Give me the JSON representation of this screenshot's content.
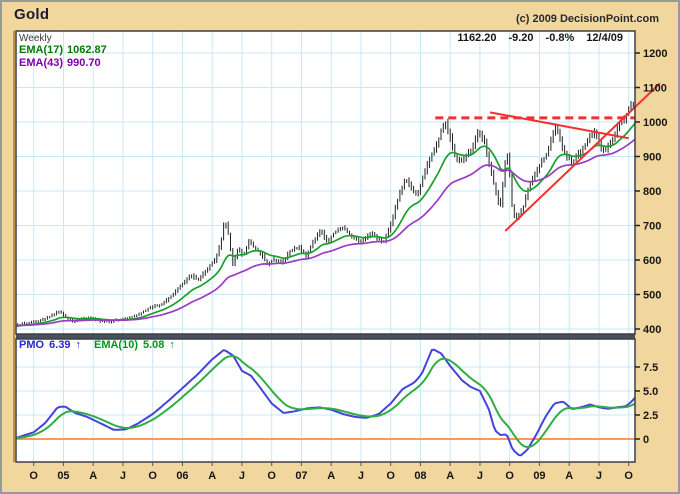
{
  "header": {
    "title": "Gold",
    "copyright": "(c) 2009 DecisionPoint.com"
  },
  "quote": {
    "last": "1162.20",
    "change": "-9.20",
    "percent": "-0.8%",
    "date": "12/4/09"
  },
  "legend": {
    "timeframe": "Weekly",
    "ema17_label": "EMA(17)",
    "ema17_value": "1062.87",
    "ema43_label": "EMA(43)",
    "ema43_value": "990.70"
  },
  "pmo_legend": {
    "pmo_label": "PMO",
    "pmo_value": "6.39",
    "pmo_arrow": "↑",
    "ema10_label": "EMA(10)",
    "ema10_value": "5.08",
    "ema10_arrow": "↑"
  },
  "colors": {
    "frame_background": "#f1d79e",
    "plot_background": "#ffffff",
    "grid": "#c9e8f8",
    "price_bars": "#222222",
    "ema17_line": "#1aa02c",
    "ema43_line": "#9a3dc4",
    "pmo_line": "#4444dd",
    "pmo_ema_line": "#2fae44",
    "zero_line": "#ff8844",
    "annotation_red": "#f23030",
    "divider": "#49505b",
    "axis_text": "#161616"
  },
  "chart_data": [
    {
      "type": "bar",
      "title": "Gold weekly price",
      "x_unit": "quarters since Oct 2004 (O 05 A J O ... O)",
      "x_tick_labels": [
        "O",
        "05",
        "A",
        "J",
        "O",
        "06",
        "A",
        "J",
        "O",
        "07",
        "A",
        "J",
        "O",
        "08",
        "A",
        "J",
        "O",
        "09",
        "A",
        "J",
        "O"
      ],
      "x_range": [
        -0.6,
        20.7
      ],
      "ylim": [
        385,
        1264
      ],
      "y_ticks": [
        1200,
        1100,
        1000,
        900,
        800,
        700,
        600,
        500,
        400
      ],
      "grid": true,
      "series": [
        {
          "name": "close",
          "type": "bars",
          "color": "#222222",
          "points": [
            [
              -0.6,
              410
            ],
            [
              -0.3,
              416
            ],
            [
              0,
              420
            ],
            [
              0.3,
              427
            ],
            [
              0.6,
              438
            ],
            [
              0.85,
              452
            ],
            [
              1.05,
              436
            ],
            [
              1.3,
              422
            ],
            [
              1.6,
              429
            ],
            [
              1.9,
              433
            ],
            [
              2.2,
              424
            ],
            [
              2.5,
              421
            ],
            [
              2.8,
              427
            ],
            [
              3.1,
              430
            ],
            [
              3.5,
              441
            ],
            [
              3.9,
              462
            ],
            [
              4.3,
              472
            ],
            [
              4.7,
              502
            ],
            [
              5,
              532
            ],
            [
              5.3,
              556
            ],
            [
              5.5,
              542
            ],
            [
              5.8,
              571
            ],
            [
              6.1,
              601
            ],
            [
              6.3,
              655
            ],
            [
              6.42,
              718
            ],
            [
              6.55,
              672
            ],
            [
              6.68,
              585
            ],
            [
              6.85,
              632
            ],
            [
              7.05,
              612
            ],
            [
              7.25,
              656
            ],
            [
              7.45,
              632
            ],
            [
              7.65,
              618
            ],
            [
              7.85,
              587
            ],
            [
              8.1,
              603
            ],
            [
              8.35,
              589
            ],
            [
              8.6,
              625
            ],
            [
              8.9,
              638
            ],
            [
              9.15,
              612
            ],
            [
              9.4,
              653
            ],
            [
              9.65,
              687
            ],
            [
              9.85,
              652
            ],
            [
              10.1,
              679
            ],
            [
              10.4,
              694
            ],
            [
              10.7,
              667
            ],
            [
              11,
              653
            ],
            [
              11.3,
              678
            ],
            [
              11.55,
              664
            ],
            [
              11.75,
              649
            ],
            [
              12,
              702
            ],
            [
              12.25,
              780
            ],
            [
              12.5,
              836
            ],
            [
              12.7,
              803
            ],
            [
              12.9,
              788
            ],
            [
              13.1,
              848
            ],
            [
              13.35,
              902
            ],
            [
              13.6,
              948
            ],
            [
              13.82,
              1006
            ],
            [
              14,
              955
            ],
            [
              14.2,
              886
            ],
            [
              14.45,
              892
            ],
            [
              14.7,
              918
            ],
            [
              14.95,
              978
            ],
            [
              15.15,
              942
            ],
            [
              15.35,
              862
            ],
            [
              15.55,
              792
            ],
            [
              15.68,
              748
            ],
            [
              15.85,
              882
            ],
            [
              15.95,
              908
            ],
            [
              16.1,
              732
            ],
            [
              16.25,
              722
            ],
            [
              16.45,
              752
            ],
            [
              16.65,
              818
            ],
            [
              16.85,
              848
            ],
            [
              17.05,
              882
            ],
            [
              17.25,
              908
            ],
            [
              17.45,
              968
            ],
            [
              17.55,
              988
            ],
            [
              17.72,
              938
            ],
            [
              17.9,
              902
            ],
            [
              18.1,
              882
            ],
            [
              18.3,
              908
            ],
            [
              18.5,
              928
            ],
            [
              18.7,
              958
            ],
            [
              18.85,
              975
            ],
            [
              19.05,
              928
            ],
            [
              19.2,
              915
            ],
            [
              19.45,
              948
            ],
            [
              19.65,
              992
            ],
            [
              19.85,
              1008
            ],
            [
              20.05,
              1044
            ],
            [
              20.2,
              1058
            ],
            [
              20.35,
              1098
            ],
            [
              20.5,
              1142
            ],
            [
              20.58,
              1168
            ],
            [
              20.64,
              1200
            ],
            [
              20.7,
              1162
            ]
          ]
        },
        {
          "name": "EMA(17)",
          "type": "ema",
          "period": 17,
          "color": "#1aa02c",
          "last_value": 1062.87
        },
        {
          "name": "EMA(43)",
          "type": "ema",
          "period": 43,
          "color": "#9a3dc4",
          "last_value": 990.7
        }
      ],
      "annotations": [
        {
          "name": "resistance-dashed-line",
          "type": "line",
          "dashed": true,
          "color": "#f23030",
          "width": 3,
          "p1": [
            13.5,
            1012
          ],
          "p2": [
            20.2,
            1012
          ]
        },
        {
          "name": "falling-trendline",
          "type": "line",
          "dashed": false,
          "color": "#f23030",
          "width": 2,
          "p1": [
            15.34,
            1028
          ],
          "p2": [
            20.0,
            953
          ]
        },
        {
          "name": "rising-trendline",
          "type": "line",
          "dashed": false,
          "color": "#f23030",
          "width": 2,
          "p1": [
            15.85,
            684
          ],
          "p2": [
            21.05,
            1112
          ]
        }
      ]
    },
    {
      "type": "line",
      "title": "PMO indicator",
      "ylim": [
        -2.4,
        9.4
      ],
      "y_ticks": [
        {
          "label": "7.5",
          "value": 7.5
        },
        {
          "label": "5.0",
          "value": 5
        },
        {
          "label": "2.5",
          "value": 2.5
        },
        {
          "label": "0",
          "value": 0
        }
      ],
      "zero_line": 0,
      "zero_line_color": "#ff8844",
      "series": [
        {
          "name": "PMO",
          "type": "line",
          "color": "#4444dd",
          "last_value": 6.39,
          "points": [
            [
              -0.6,
              0.1
            ],
            [
              -0.3,
              0.4
            ],
            [
              0,
              0.7
            ],
            [
              0.4,
              1.7
            ],
            [
              0.8,
              3.3
            ],
            [
              1.05,
              3.4
            ],
            [
              1.4,
              2.7
            ],
            [
              1.8,
              2.3
            ],
            [
              2.2,
              1.7
            ],
            [
              2.7,
              0.95
            ],
            [
              3.1,
              1.0
            ],
            [
              3.5,
              1.6
            ],
            [
              4,
              2.6
            ],
            [
              4.5,
              3.9
            ],
            [
              5,
              5.3
            ],
            [
              5.5,
              6.7
            ],
            [
              6,
              8.3
            ],
            [
              6.4,
              9.3
            ],
            [
              6.7,
              8.7
            ],
            [
              7,
              7.1
            ],
            [
              7.3,
              6.6
            ],
            [
              7.6,
              5.4
            ],
            [
              8,
              3.7
            ],
            [
              8.4,
              2.7
            ],
            [
              8.8,
              2.9
            ],
            [
              9.2,
              3.2
            ],
            [
              9.6,
              3.3
            ],
            [
              10,
              3.05
            ],
            [
              10.4,
              2.6
            ],
            [
              10.8,
              2.3
            ],
            [
              11.2,
              2.2
            ],
            [
              11.6,
              2.6
            ],
            [
              12,
              3.7
            ],
            [
              12.4,
              5.2
            ],
            [
              12.8,
              5.9
            ],
            [
              13.05,
              6.8
            ],
            [
              13.4,
              9.4
            ],
            [
              13.7,
              8.9
            ],
            [
              14,
              7.6
            ],
            [
              14.4,
              6.1
            ],
            [
              14.7,
              5.4
            ],
            [
              15,
              5.0
            ],
            [
              15.3,
              3.1
            ],
            [
              15.5,
              0.9
            ],
            [
              15.7,
              0.4
            ],
            [
              15.9,
              0.5
            ],
            [
              16.1,
              -1.1
            ],
            [
              16.35,
              -1.8
            ],
            [
              16.6,
              -1.1
            ],
            [
              16.9,
              0.5
            ],
            [
              17.2,
              2.3
            ],
            [
              17.5,
              3.7
            ],
            [
              17.8,
              3.9
            ],
            [
              18.1,
              3.1
            ],
            [
              18.45,
              3.35
            ],
            [
              18.7,
              3.6
            ],
            [
              19,
              3.3
            ],
            [
              19.3,
              3.15
            ],
            [
              19.6,
              3.3
            ],
            [
              19.9,
              3.4
            ],
            [
              20.1,
              3.9
            ],
            [
              20.35,
              4.8
            ],
            [
              20.55,
              5.7
            ],
            [
              20.7,
              6.39
            ]
          ]
        },
        {
          "name": "EMA(10)",
          "type": "ema",
          "period": 10,
          "color": "#2fae44",
          "last_value": 5.08
        }
      ]
    }
  ]
}
